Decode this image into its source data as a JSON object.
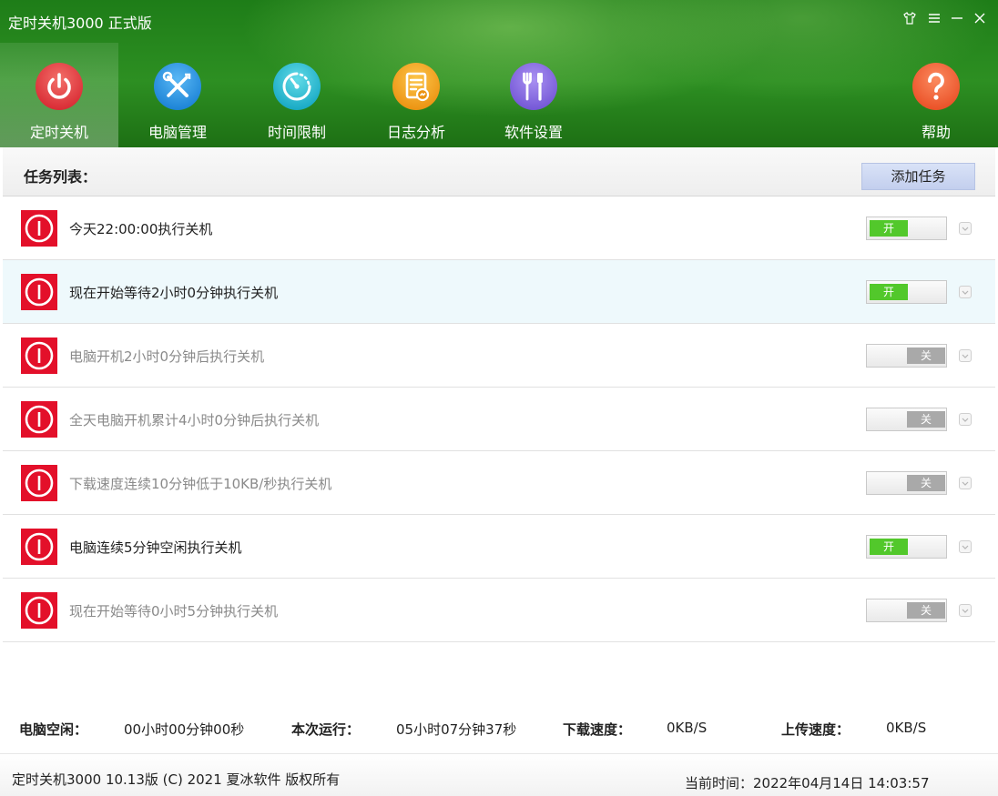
{
  "window": {
    "title": "定时关机3000 正式版",
    "controls": [
      "skin-icon",
      "menu-icon",
      "minimize-icon",
      "close-icon"
    ]
  },
  "nav": {
    "items": [
      {
        "label": "定时关机",
        "icon": "power-icon",
        "color": "#e84448",
        "active": true
      },
      {
        "label": "电脑管理",
        "icon": "tools-icon",
        "color": "#2f9de8"
      },
      {
        "label": "时间限制",
        "icon": "timer-icon",
        "color": "#2bbfd6"
      },
      {
        "label": "日志分析",
        "icon": "log-icon",
        "color": "#f0a21c"
      },
      {
        "label": "软件设置",
        "icon": "settings-icon",
        "color": "#8d6ee0"
      }
    ],
    "help": {
      "label": "帮助",
      "icon": "help-icon",
      "color": "#f06a3a"
    }
  },
  "toolbar": {
    "task_list_label": "任务列表：",
    "add_task_label": "添加任务"
  },
  "tasks": [
    {
      "text": "今天22:00:00执行关机",
      "state": "开",
      "on": true
    },
    {
      "text": "现在开始等待2小时0分钟执行关机",
      "state": "开",
      "on": true
    },
    {
      "text": "电脑开机2小时0分钟后执行关机",
      "state": "关",
      "on": false
    },
    {
      "text": "全天电脑开机累计4小时0分钟后执行关机",
      "state": "关",
      "on": false
    },
    {
      "text": "下载速度连续10分钟低于10KB/秒执行关机",
      "state": "关",
      "on": false
    },
    {
      "text": "电脑连续5分钟空闲执行关机",
      "state": "开",
      "on": true
    },
    {
      "text": "现在开始等待0小时5分钟执行关机",
      "state": "关",
      "on": false
    }
  ],
  "status": {
    "idle_label": "电脑空闲：",
    "idle_value": "00小时00分钟00秒",
    "run_label": "本次运行：",
    "run_value": "05小时07分钟37秒",
    "download_label": "下载速度：",
    "download_value": "0KB/S",
    "upload_label": "上传速度：",
    "upload_value": "0KB/S"
  },
  "footer": {
    "copyright": "定时关机3000  10.13版  (C)  2021  夏冰软件 版权所有",
    "current_time": "当前时间：2022年04月14日 14:03:57"
  },
  "colors": {
    "header_green": "#2d8f22",
    "power_red": "#e3102a",
    "toggle_on": "#52c82b",
    "toggle_off": "#a9a9a9",
    "row_hover": "#eef9fc"
  }
}
